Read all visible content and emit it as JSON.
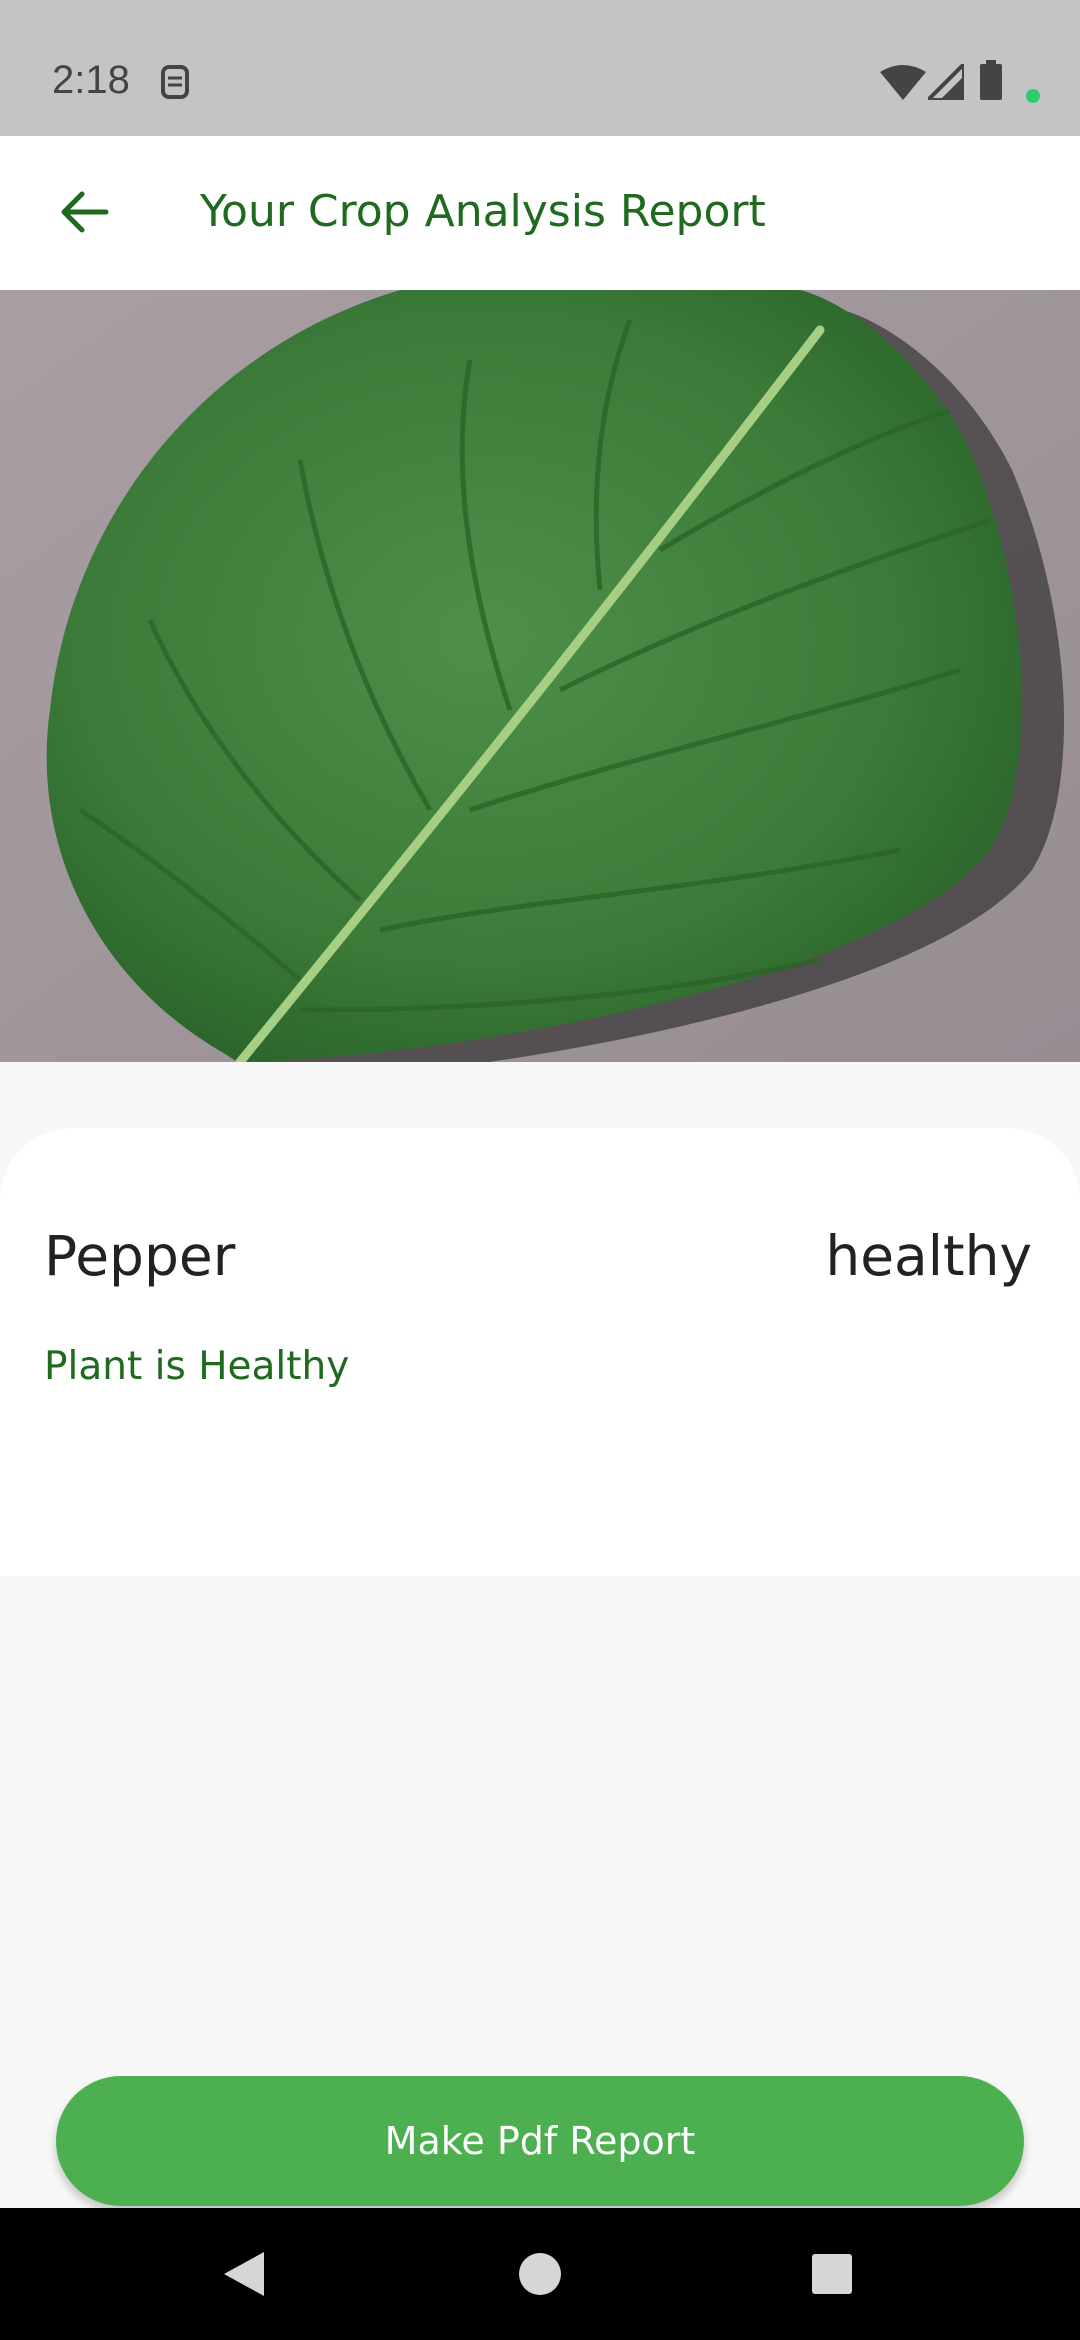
{
  "status_bar": {
    "time": "2:18",
    "icons": [
      "sim-icon",
      "wifi-icon",
      "signal-icon",
      "battery-icon",
      "notification-dot-icon"
    ],
    "dot_color": "#2ecc71"
  },
  "app_bar": {
    "back_icon": "arrow-left-icon",
    "title": "Your Crop Analysis Report"
  },
  "image": {
    "subject": "leaf-photo"
  },
  "result": {
    "crop": "Pepper",
    "status": "healthy",
    "message": "Plant is Healthy"
  },
  "actions": {
    "pdf_button": "Make Pdf Report"
  },
  "nav_bar": {
    "icons": [
      "back-triangle-icon",
      "home-circle-icon",
      "recents-square-icon"
    ]
  },
  "colors": {
    "accent_dark": "#1f6a1f",
    "button": "#4caf50"
  }
}
